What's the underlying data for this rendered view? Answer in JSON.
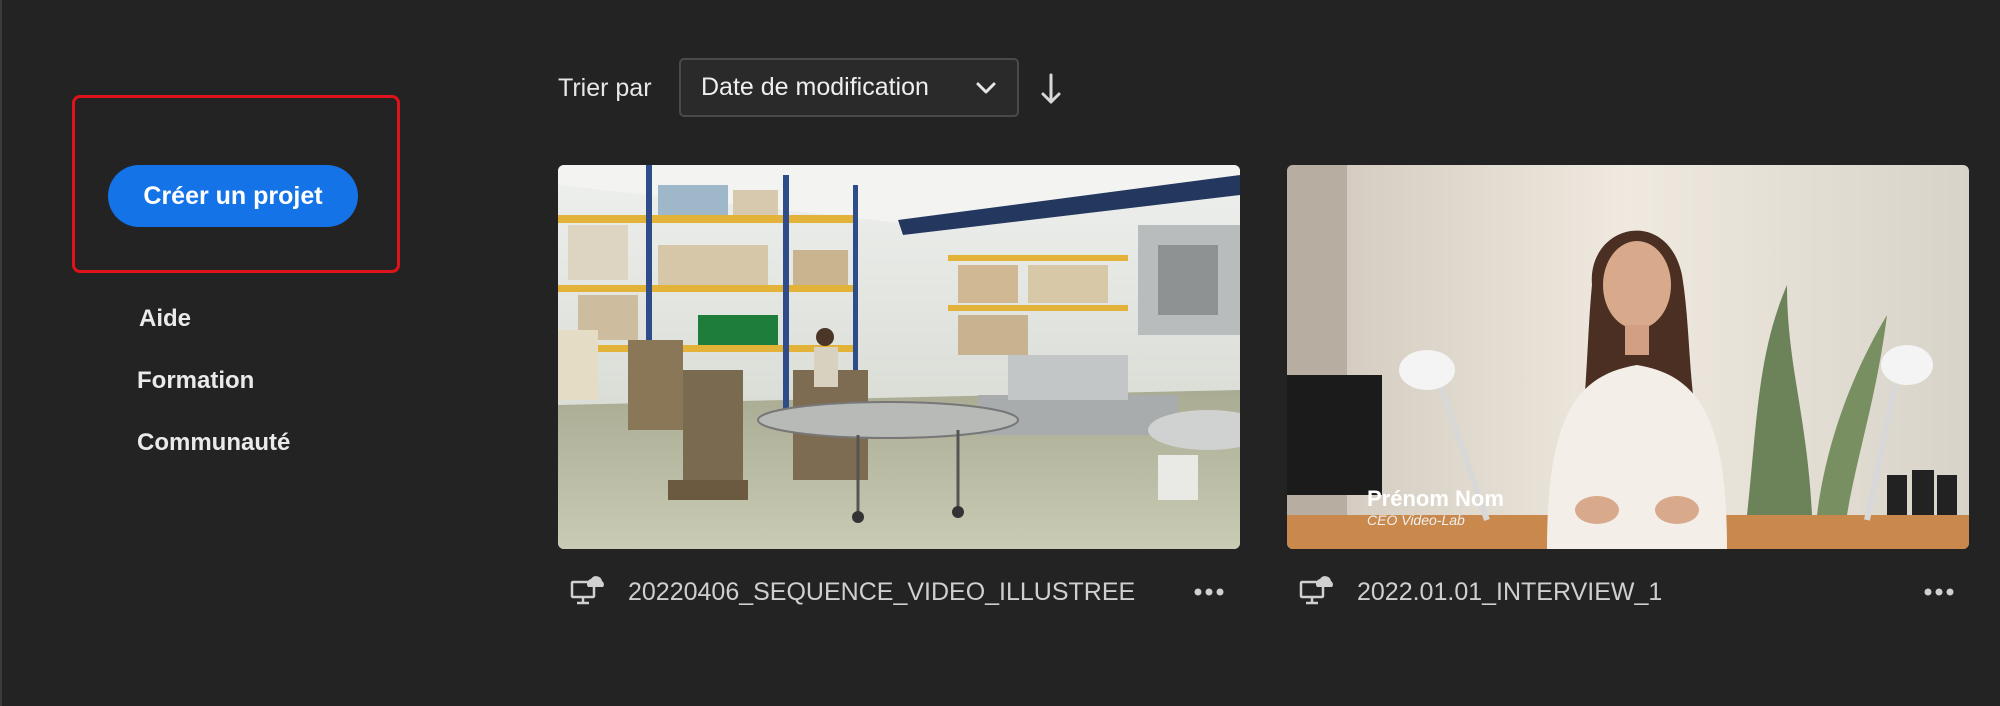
{
  "sidebar": {
    "create_button": "Créer un projet",
    "links": [
      "Aide",
      "Formation",
      "Communauté"
    ]
  },
  "sort": {
    "label": "Trier par",
    "selected": "Date de modification",
    "direction": "descending"
  },
  "projects": [
    {
      "title": "20220406_SEQUENCE_VIDEO_ILLUSTREE",
      "thumbnail": "factory warehouse scene"
    },
    {
      "title": "2022.01.01_INTERVIEW_1",
      "thumbnail": "woman interview with name lower-third",
      "overlay_name": "Prénom Nom",
      "overlay_subtitle": "CEO Video-Lab"
    }
  ],
  "colors": {
    "accent": "#1473e6",
    "highlight": "#e0131c",
    "background": "#232323"
  }
}
